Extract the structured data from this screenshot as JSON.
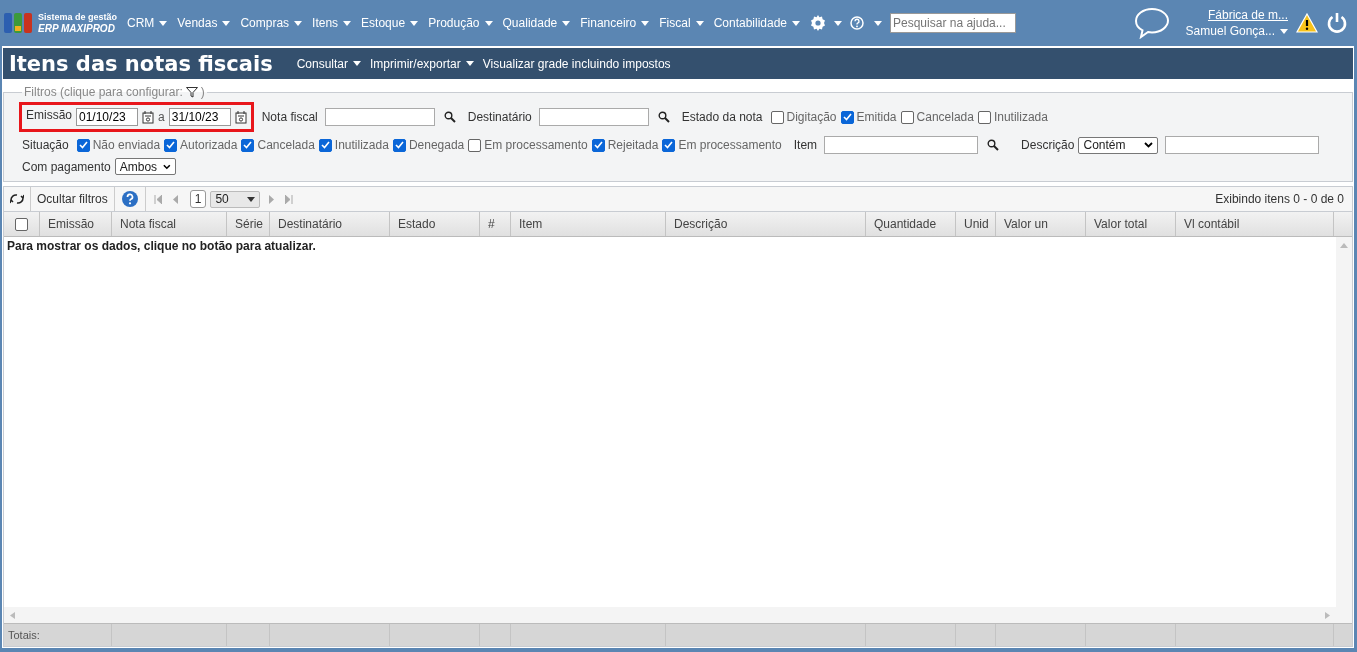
{
  "logo": {
    "line1": "Sistema de gestão",
    "line2": "ERP MAXIPROD"
  },
  "menu": [
    {
      "label": "CRM"
    },
    {
      "label": "Vendas"
    },
    {
      "label": "Compras"
    },
    {
      "label": "Itens"
    },
    {
      "label": "Estoque"
    },
    {
      "label": "Produção"
    },
    {
      "label": "Qualidade"
    },
    {
      "label": "Financeiro"
    },
    {
      "label": "Fiscal"
    },
    {
      "label": "Contabilidade"
    }
  ],
  "help_search": {
    "placeholder": "Pesquisar na ajuda..."
  },
  "account": {
    "company": "Fábrica de m...",
    "user": "Samuel Gonça..."
  },
  "page_title": "Itens das notas fiscais",
  "page_actions": [
    {
      "label": "Consultar",
      "dropdown": true
    },
    {
      "label": "Imprimir/exportar",
      "dropdown": true
    },
    {
      "label": "Visualizar grade incluindo impostos",
      "dropdown": false
    }
  ],
  "filters": {
    "legend": "Filtros (clique para configurar:",
    "legend_end": ")",
    "emission": {
      "label": "Emissão",
      "from": "01/10/23",
      "separator": "a",
      "to": "31/10/23",
      "highlighted": true
    },
    "invoice": {
      "label": "Nota fiscal"
    },
    "recipient": {
      "label": "Destinatário"
    },
    "state": {
      "label": "Estado da nota",
      "options": [
        {
          "label": "Digitação",
          "checked": false
        },
        {
          "label": "Emitida",
          "checked": true
        },
        {
          "label": "Cancelada",
          "checked": false
        },
        {
          "label": "Inutilizada",
          "checked": false
        }
      ]
    },
    "situation": {
      "label": "Situação",
      "options": [
        {
          "label": "Não enviada",
          "checked": true
        },
        {
          "label": "Autorizada",
          "checked": true
        },
        {
          "label": "Cancelada",
          "checked": true
        },
        {
          "label": "Inutilizada",
          "checked": true
        },
        {
          "label": "Denegada",
          "checked": true
        },
        {
          "label": "Em processamento",
          "checked": false
        },
        {
          "label": "Rejeitada",
          "checked": true
        },
        {
          "label": "Em processamento",
          "checked": true
        }
      ]
    },
    "item": {
      "label": "Item"
    },
    "description": {
      "label": "Descrição",
      "mode": "Contém"
    },
    "payment": {
      "label": "Com pagamento",
      "value": "Ambos"
    }
  },
  "toolbar": {
    "hide_filters": "Ocultar filtros",
    "page": "1",
    "page_size": "50",
    "summary": "Exibindo itens 0 - 0 de 0"
  },
  "table": {
    "columns": [
      "Emissão",
      "Nota fiscal",
      "Série",
      "Destinatário",
      "Estado",
      "#",
      "Item",
      "Descrição",
      "Quantidade",
      "Unid",
      "Valor un",
      "Valor total",
      "Vl contábil"
    ],
    "select_all_checked": false,
    "empty_message": "Para mostrar os dados, clique no botão para atualizar.",
    "totals_label": "Totais:"
  }
}
